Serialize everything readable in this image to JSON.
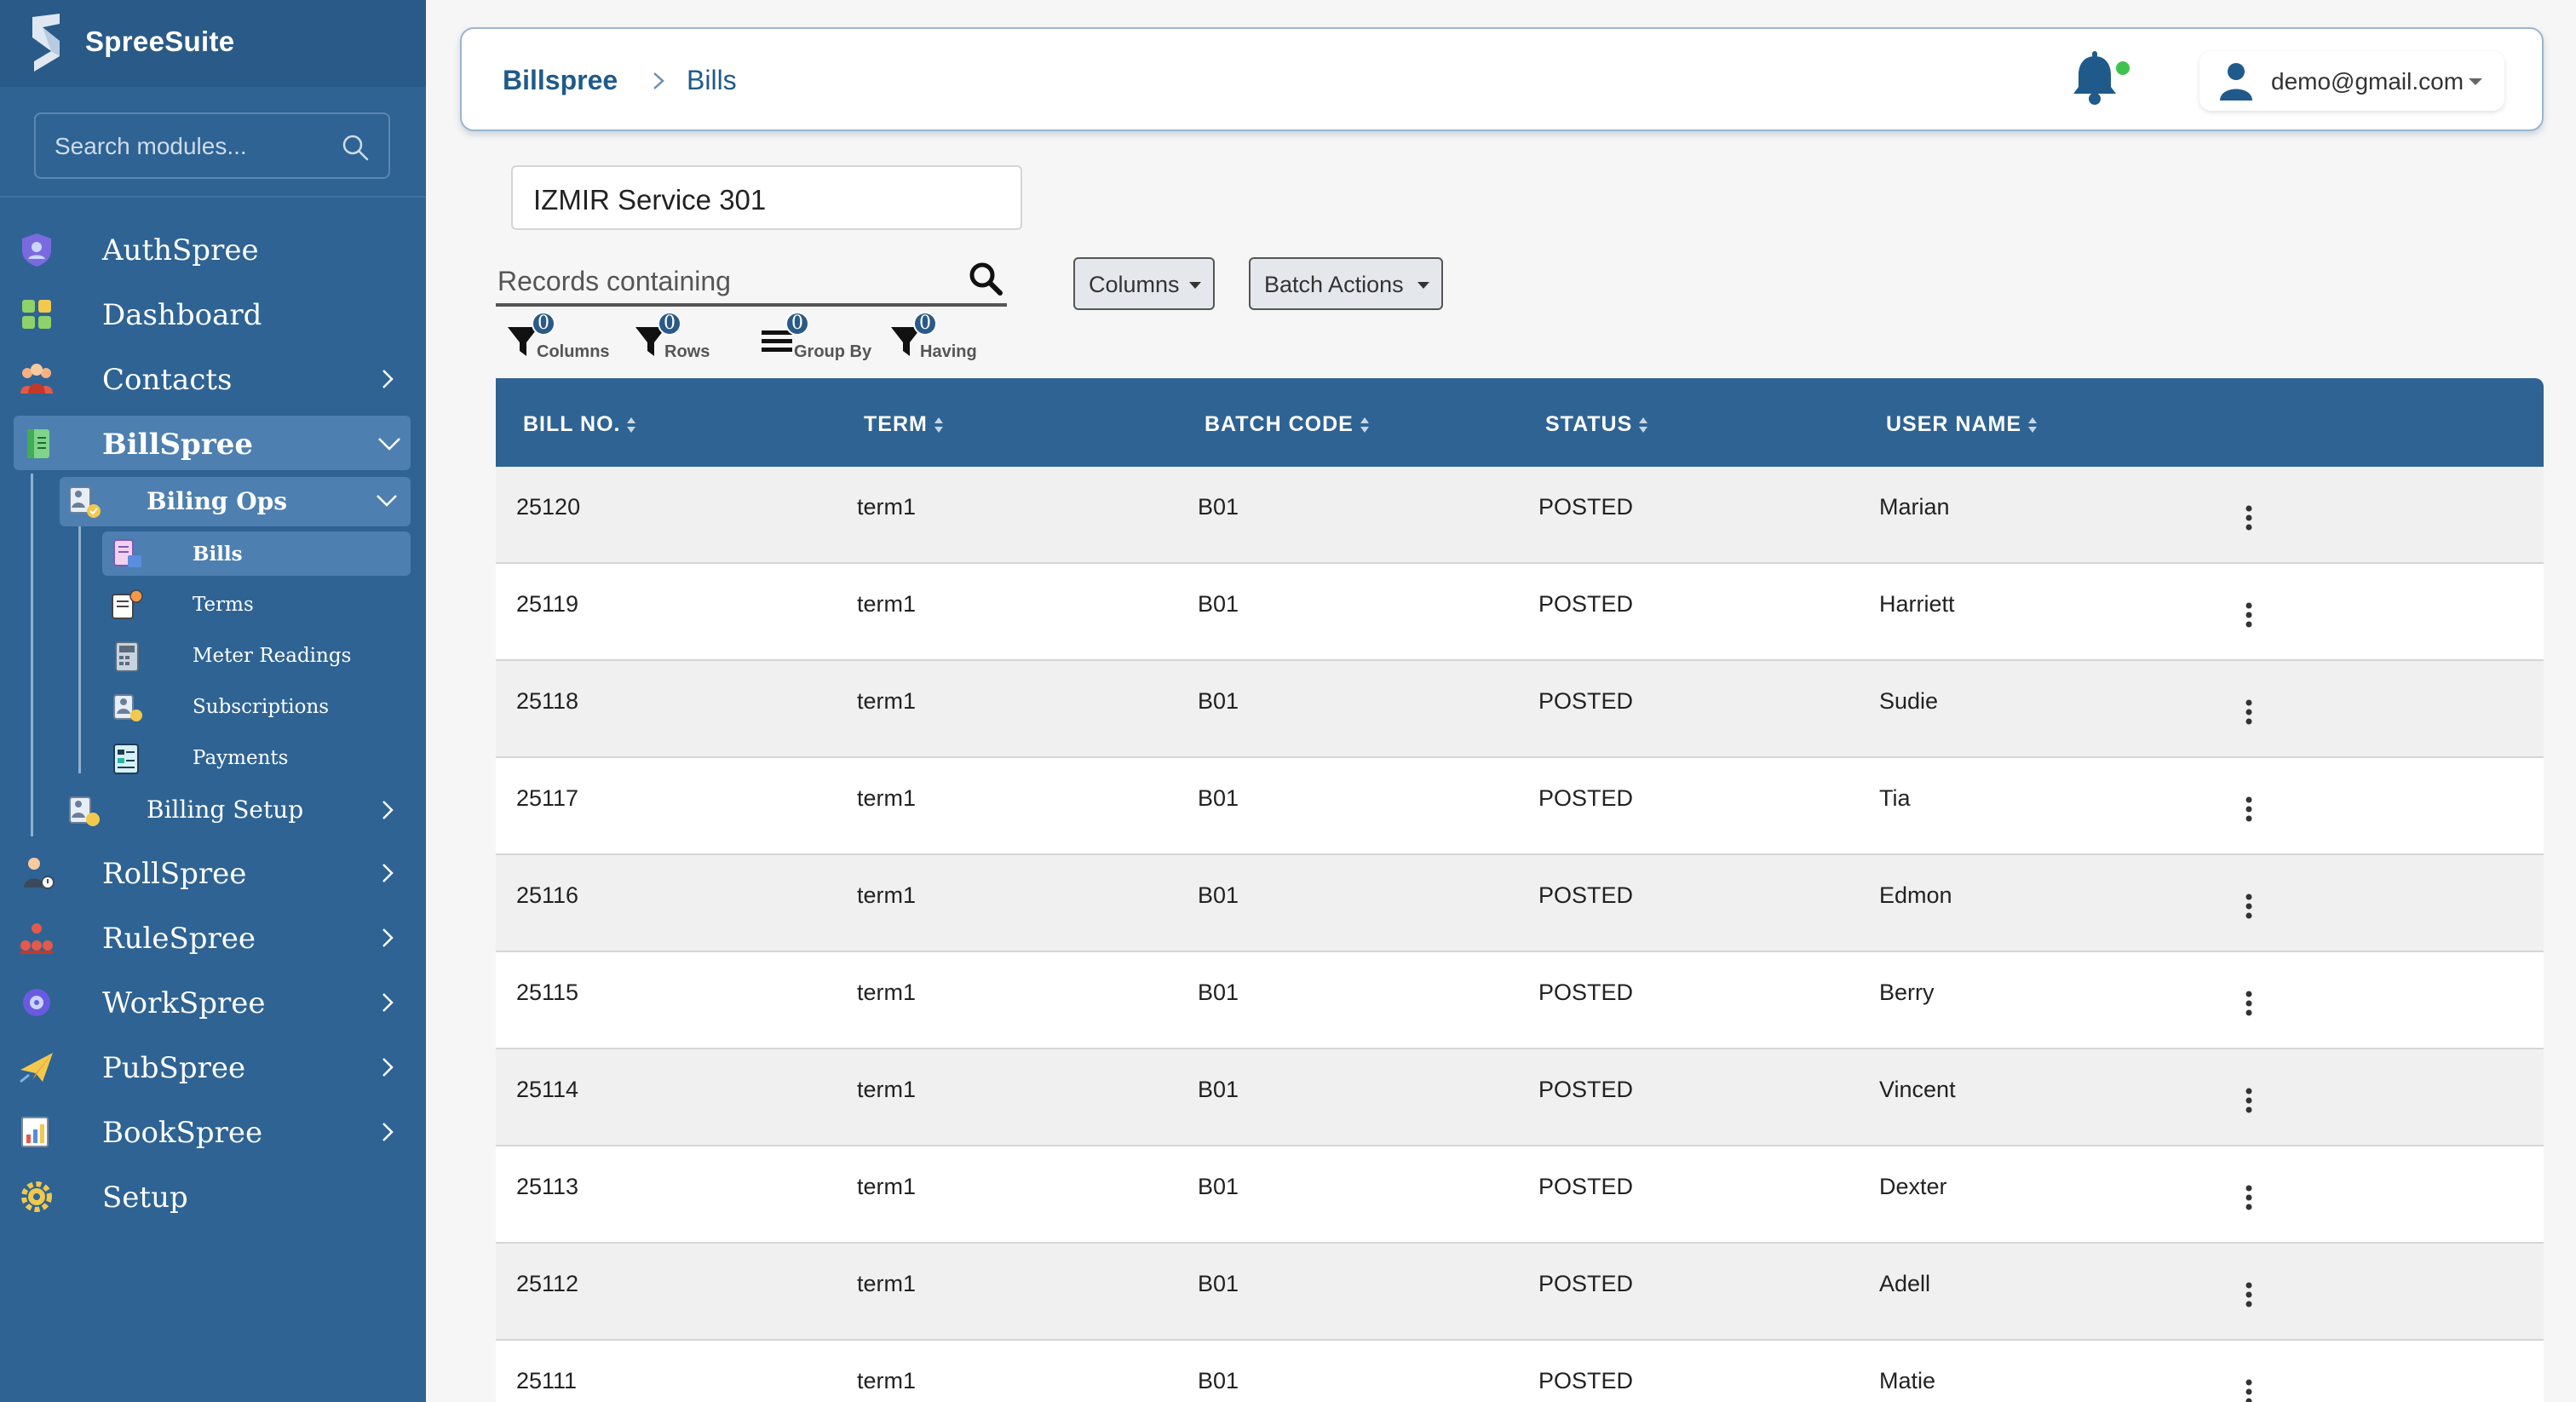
{
  "app": {
    "name": "SpreeSuite"
  },
  "search": {
    "placeholder": "Search modules..."
  },
  "nav": {
    "authspree": "AuthSpree",
    "dashboard": "Dashboard",
    "contacts": "Contacts",
    "billspree": "BillSpree",
    "billing_ops": "Biling Ops",
    "sub_items": [
      "Bills",
      "Terms",
      "Meter Readings",
      "Subscriptions",
      "Payments"
    ],
    "billing_setup": "Billing Setup",
    "rollspree": "RollSpree",
    "rulespree": "RuleSpree",
    "workspree": "WorkSpree",
    "pubspree": "PubSpree",
    "bookspree": "BookSpree",
    "setup": "Setup"
  },
  "header": {
    "breadcrumb_root": "Billspree",
    "breadcrumb_current": "Bills",
    "user_email": "demo@gmail.com"
  },
  "filters": {
    "org_value": "IZMIR Service 301",
    "records_placeholder": "Records containing",
    "columns_btn": "Columns",
    "batch_btn": "Batch Actions",
    "tools": [
      {
        "label": "Columns",
        "count": "0"
      },
      {
        "label": "Rows",
        "count": "0"
      },
      {
        "label": "Group By",
        "count": "0"
      },
      {
        "label": "Having",
        "count": "0"
      }
    ]
  },
  "table": {
    "columns": [
      "BILL NO.",
      "TERM",
      "BATCH CODE",
      "STATUS",
      "USER NAME"
    ],
    "rows": [
      [
        "25120",
        "term1",
        "B01",
        "POSTED",
        "Marian"
      ],
      [
        "25119",
        "term1",
        "B01",
        "POSTED",
        "Harriett"
      ],
      [
        "25118",
        "term1",
        "B01",
        "POSTED",
        "Sudie"
      ],
      [
        "25117",
        "term1",
        "B01",
        "POSTED",
        "Tia"
      ],
      [
        "25116",
        "term1",
        "B01",
        "POSTED",
        "Edmon"
      ],
      [
        "25115",
        "term1",
        "B01",
        "POSTED",
        "Berry"
      ],
      [
        "25114",
        "term1",
        "B01",
        "POSTED",
        "Vincent"
      ],
      [
        "25113",
        "term1",
        "B01",
        "POSTED",
        "Dexter"
      ],
      [
        "25112",
        "term1",
        "B01",
        "POSTED",
        "Adell"
      ],
      [
        "25111",
        "term1",
        "B01",
        "POSTED",
        "Matie"
      ]
    ]
  },
  "colors": {
    "sidebar": "#2e6394",
    "sidebar_active": "#4d7fb0",
    "table_header": "#2e6394",
    "breadcrumb": "#1f5a8b",
    "online_dot": "#3ec34f"
  },
  "icons": {
    "brand": "spreesuite-logo",
    "search": "search-icon",
    "notification": "bell-icon",
    "user": "user-icon",
    "row_menu": "kebab-icon"
  }
}
